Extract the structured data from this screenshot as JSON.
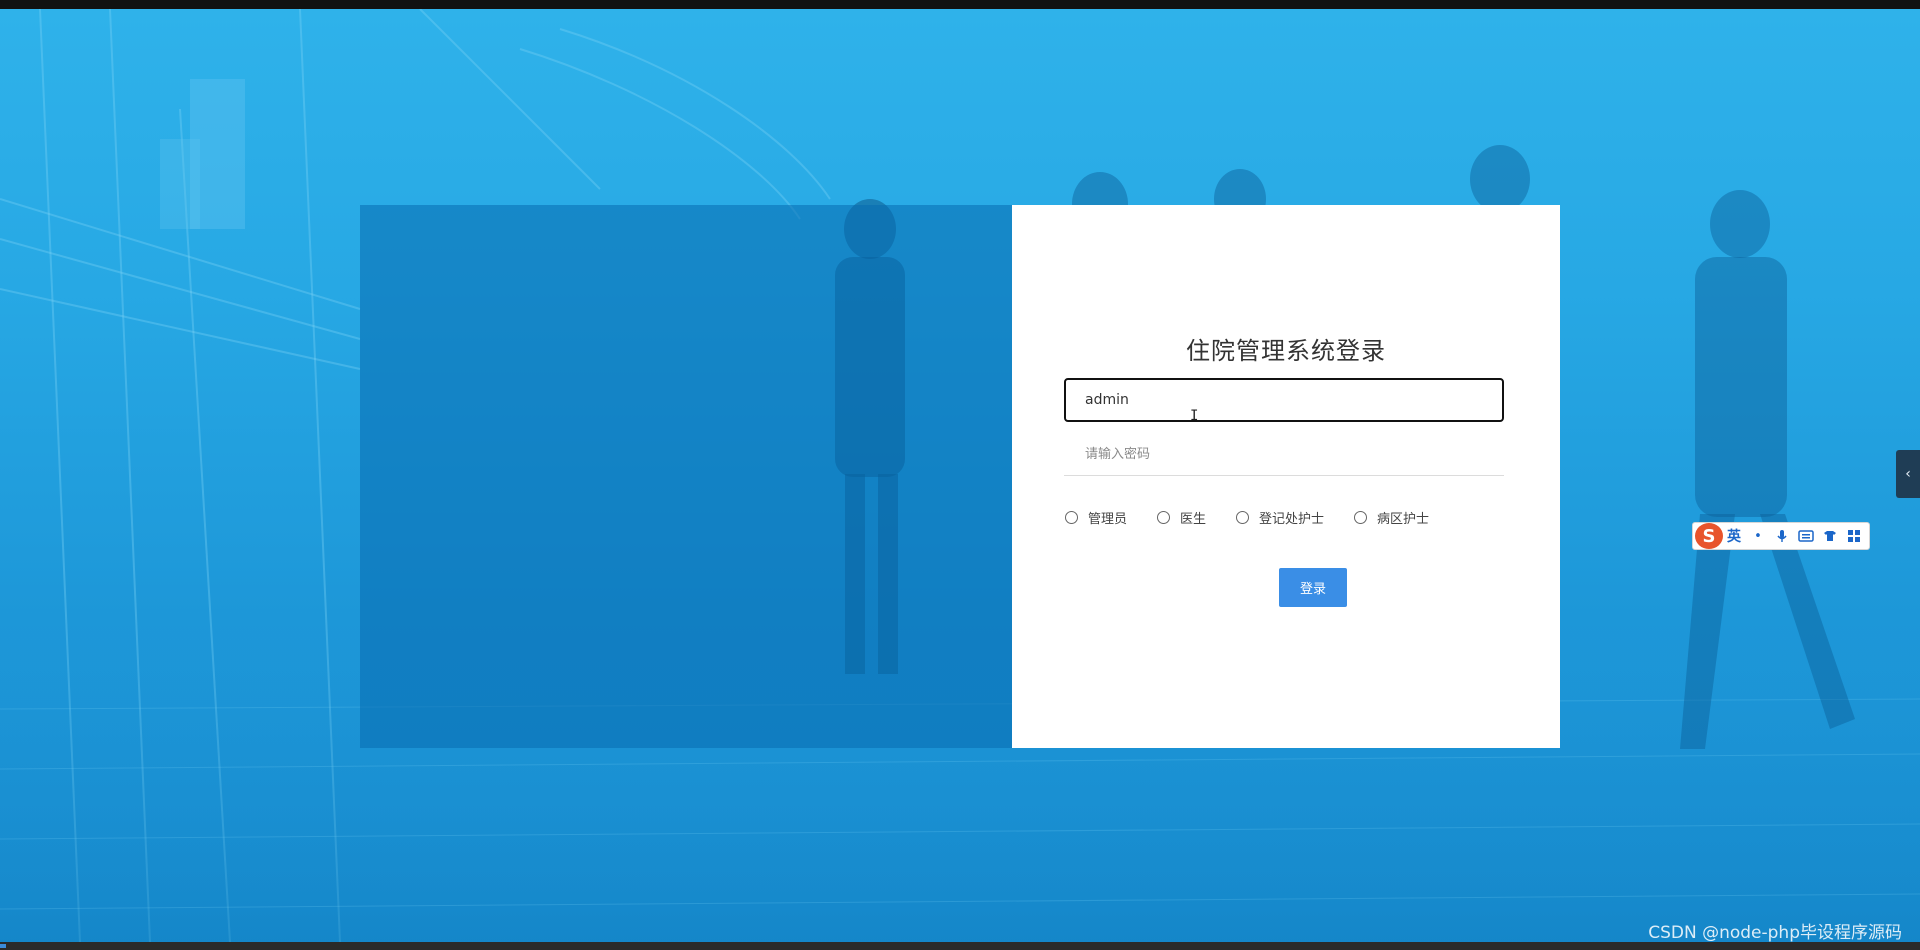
{
  "login": {
    "title": "住院管理系统登录",
    "username_value": "admin",
    "password_placeholder": "请输入密码",
    "roles": [
      "管理员",
      "医生",
      "登记处护士",
      "病区护士"
    ],
    "submit_label": "登录"
  },
  "ime": {
    "logo": "S",
    "mode": "英",
    "icons": [
      "punctuation-icon",
      "microphone-icon",
      "keyboard-icon",
      "skin-icon",
      "grid-icon"
    ]
  },
  "side_tab": {
    "icon": "chevron-left-icon"
  },
  "watermark": "CSDN @node-php毕设程序源码",
  "colors": {
    "background": "#27a8e4",
    "panel_overlay": "#086cb0",
    "button": "#3a8ee6",
    "card": "#ffffff"
  }
}
